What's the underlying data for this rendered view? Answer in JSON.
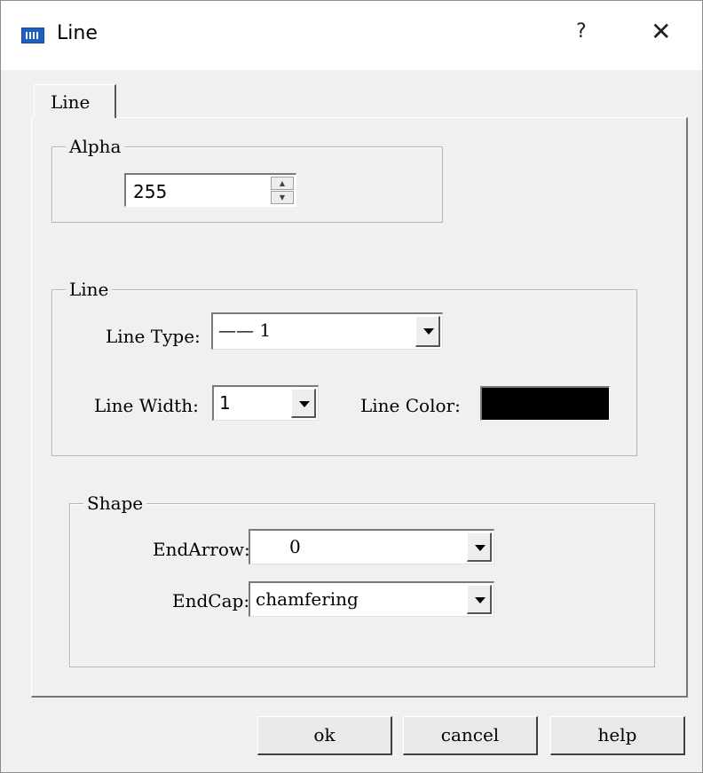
{
  "window": {
    "title": "Line",
    "help_glyph": "?",
    "close_glyph": "✕"
  },
  "tabs": [
    {
      "label": "Line",
      "selected": true
    }
  ],
  "alpha_group": {
    "legend": "Alpha",
    "value": "255"
  },
  "line_group": {
    "legend": "Line",
    "line_type_label": "Line Type:",
    "line_type_value": "—— 1",
    "line_width_label": "Line Width:",
    "line_width_value": "1",
    "line_color_label": "Line Color:",
    "line_color": "#000000"
  },
  "shape_group": {
    "legend": "Shape",
    "end_arrow_label": "EndArrow:",
    "end_arrow_value": "0",
    "end_cap_label": "EndCap:",
    "end_cap_value": "chamfering"
  },
  "buttons": {
    "ok": "ok",
    "cancel": "cancel",
    "help": "help"
  }
}
